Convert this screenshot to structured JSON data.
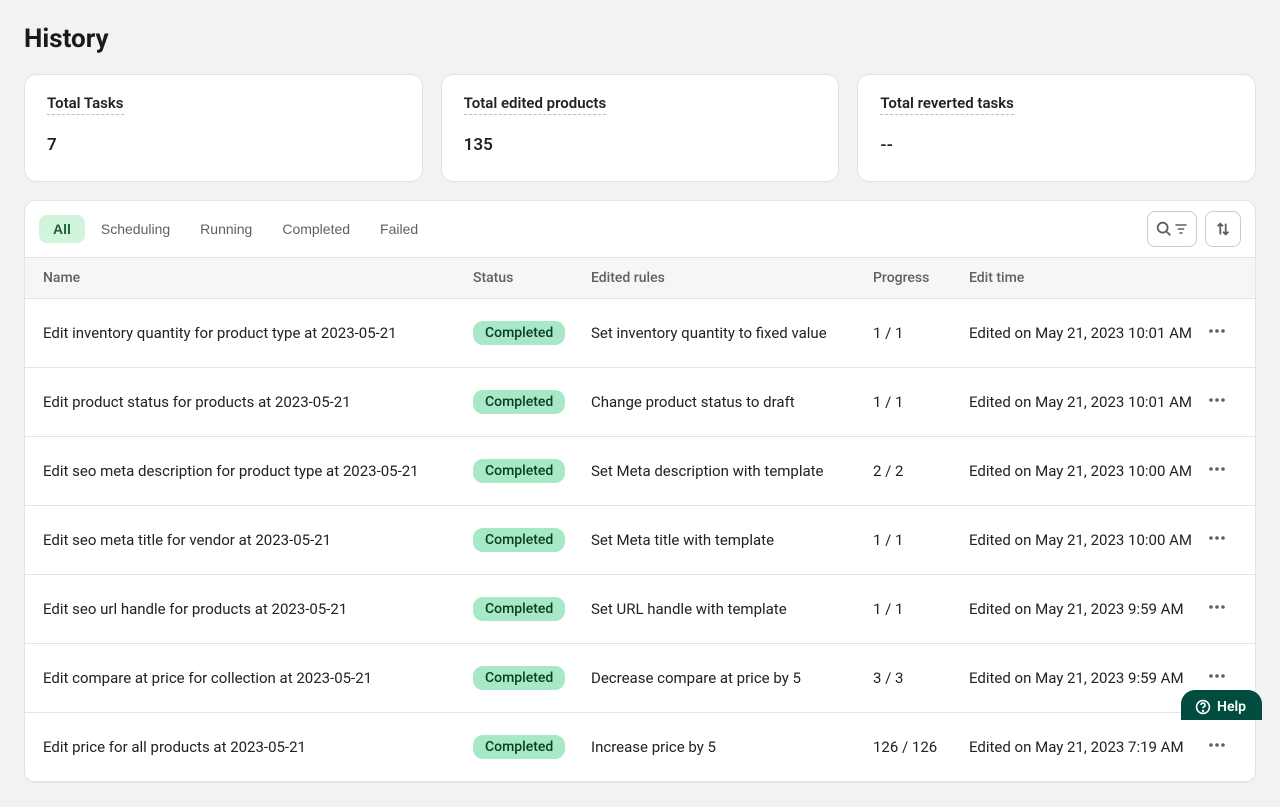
{
  "page_title": "History",
  "stats": [
    {
      "title": "Total Tasks",
      "value": "7"
    },
    {
      "title": "Total edited products",
      "value": "135"
    },
    {
      "title": "Total reverted tasks",
      "value": "--"
    }
  ],
  "tabs": [
    "All",
    "Scheduling",
    "Running",
    "Completed",
    "Failed"
  ],
  "active_tab_index": 0,
  "columns": {
    "name": "Name",
    "status": "Status",
    "rules": "Edited rules",
    "progress": "Progress",
    "time": "Edit time"
  },
  "rows": [
    {
      "name": "Edit inventory quantity for product type at 2023-05-21",
      "status": "Completed",
      "rules": "Set inventory quantity to fixed value",
      "progress": "1 / 1",
      "time": "Edited on May 21, 2023 10:01 AM"
    },
    {
      "name": "Edit product status for products at 2023-05-21",
      "status": "Completed",
      "rules": "Change product status to draft",
      "progress": "1 / 1",
      "time": "Edited on May 21, 2023 10:01 AM"
    },
    {
      "name": "Edit seo meta description for product type at 2023-05-21",
      "status": "Completed",
      "rules": "Set Meta description with template",
      "progress": "2 / 2",
      "time": "Edited on May 21, 2023 10:00 AM"
    },
    {
      "name": "Edit seo meta title for vendor at 2023-05-21",
      "status": "Completed",
      "rules": "Set Meta title with template",
      "progress": "1 / 1",
      "time": "Edited on May 21, 2023 10:00 AM"
    },
    {
      "name": "Edit seo url handle for products at 2023-05-21",
      "status": "Completed",
      "rules": "Set URL handle with template",
      "progress": "1 / 1",
      "time": "Edited on May 21, 2023 9:59 AM"
    },
    {
      "name": "Edit compare at price for collection at 2023-05-21",
      "status": "Completed",
      "rules": "Decrease compare at price by 5",
      "progress": "3 / 3",
      "time": "Edited on May 21, 2023 9:59 AM"
    },
    {
      "name": "Edit price for all products at 2023-05-21",
      "status": "Completed",
      "rules": "Increase price by 5",
      "progress": "126 / 126",
      "time": "Edited on May 21, 2023 7:19 AM"
    }
  ],
  "help_label": "Help"
}
